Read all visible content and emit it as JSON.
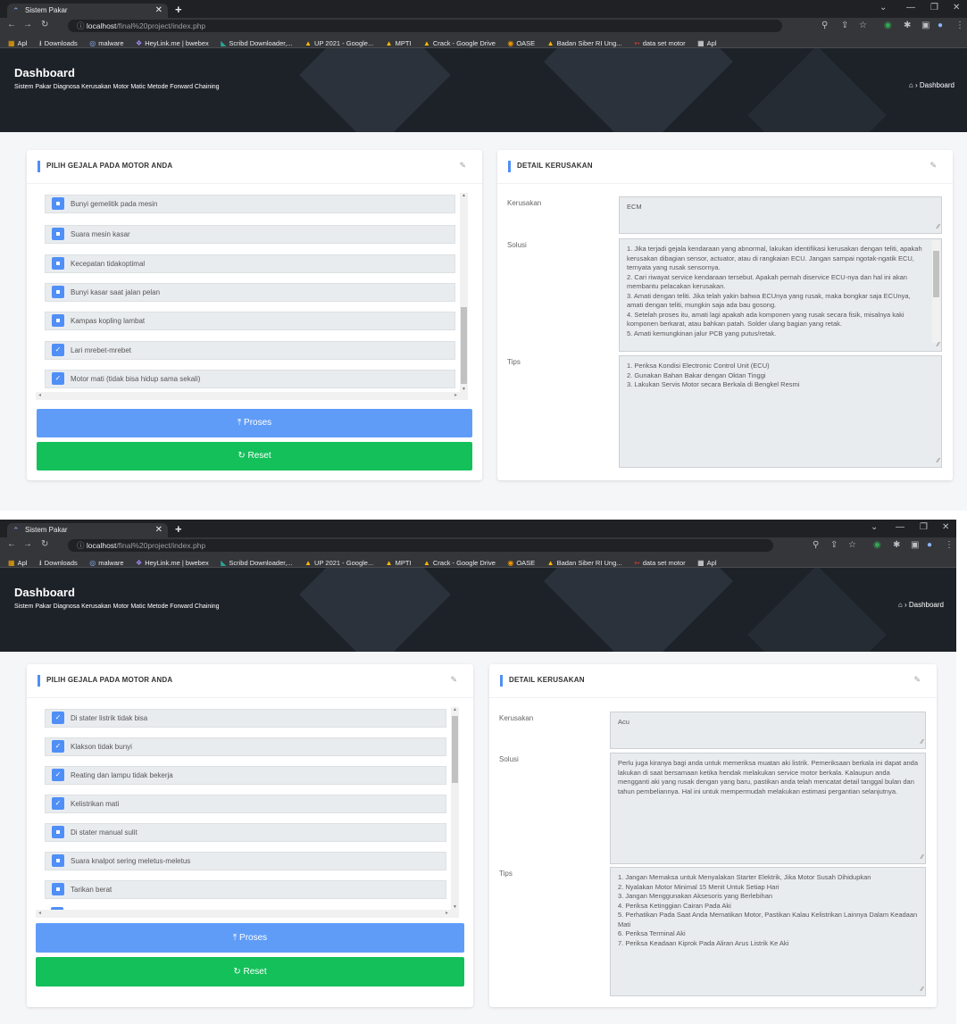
{
  "browser": {
    "tab_title": "Sistem Pakar",
    "url_host": "localhost",
    "url_path": "/final%20project/index.php",
    "bookmarks": [
      "Apl",
      "Downloads",
      "malware",
      "HeyLink.me | bwebex",
      "Scribd Downloader,...",
      "UP 2021 - Google...",
      "MPTI",
      "Crack - Google Drive",
      "OASE",
      "Badan Siber RI Ung...",
      "data set motor",
      "Apl"
    ]
  },
  "header": {
    "title": "Dashboard",
    "subtitle": "Sistem Pakar Diagnosa Kerusakan Motor Matic Metode Forward Chaining",
    "breadcrumb": "› Dashboard"
  },
  "panels": {
    "symptoms_title": "PILIH GEJALA PADA MOTOR ANDA",
    "detail_title": "DETAIL KERUSAKAN",
    "label_kerusakan": "Kerusakan",
    "label_solusi": "Solusi",
    "label_tips": "Tips",
    "proses_label": "Proses",
    "reset_label": "Reset"
  },
  "screen1": {
    "symptoms": [
      {
        "label": "Bunyi gemelitik pada mesin",
        "checked": false
      },
      {
        "label": "Suara mesin kasar",
        "checked": false
      },
      {
        "label": "Kecepatan tidakoptimal",
        "checked": false
      },
      {
        "label": "Bunyi kasar saat jalan pelan",
        "checked": false
      },
      {
        "label": "Kampas kopling lambat",
        "checked": false
      },
      {
        "label": "Lari mrebet-mrebet",
        "checked": true
      },
      {
        "label": "Motor mati (tidak bisa hidup sama sekali)",
        "checked": true
      }
    ],
    "kerusakan": "ECM",
    "solusi": "1. Jika terjadi gejala kendaraan yang abnormal, lakukan identifikasi kerusakan dengan teliti, apakah kerusakan dibagian sensor, actuator, atau di rangkaian ECU. Jangan sampai ngotak-ngatik ECU, ternyata yang rusak sensornya.\n2. Cari riwayat service kendaraan tersebut. Apakah pernah diservice ECU-nya dan hal ini akan membantu pelacakan kerusakan.\n3. Amati dengan teliti. Jika telah yakin bahwa ECUnya yang rusak, maka bongkar saja ECUnya, amati dengan teliti, mungkin saja ada bau gosong.\n4. Setelah proses itu, amati lagi apakah ada komponen yang rusak secara fisik, misalnya kaki komponen berkarat, atau bahkan patah. Solder ulang bagian yang retak.\n5. Amati kemungkinan jalur PCB yang putus/retak.",
    "tips": "1. Periksa Kondisi Electronic Control Unit (ECU)\n2. Gunakan Bahan Bakar dengan Oktan Tinggi\n3. Lakukan Servis Motor secara Berkala di Bengkel Resmi"
  },
  "screen2": {
    "symptoms": [
      {
        "label": "Di stater listrik tidak bisa",
        "checked": true
      },
      {
        "label": "Klakson tidak bunyi",
        "checked": true
      },
      {
        "label": "Reating dan lampu tidak bekerja",
        "checked": true
      },
      {
        "label": "Kelistrikan mati",
        "checked": true
      },
      {
        "label": "Di stater manual sulit",
        "checked": false
      },
      {
        "label": "Suara knalpot sering meletus-meletus",
        "checked": false
      },
      {
        "label": "Tarikan berat",
        "checked": false
      }
    ],
    "kerusakan": "Acu",
    "solusi": "Perlu juga kiranya bagi anda untuk memeriksa muatan aki listrik. Pemeriksaan berkala ini dapat anda lakukan di saat bersamaan ketika hendak melakukan service motor berkala. Kalaupun anda mengganti aki yang rusak dengan yang baru, pastikan anda telah mencatat detail tanggal bulan dan tahun pembeliannya. Hal ini untuk mempermudah melakukan estimasi pergantian selanjutnya.",
    "tips": "1. Jangan Memaksa untuk Menyalakan Starter Elektrik, Jika Motor Susah Dihidupkan\n2. Nyalakan Motor Minimal 15 Menit Untuk Setiap Hari\n3. Jangan Menggunakan Aksesoris yang Berlebihan\n4. Periksa Ketinggian Cairan Pada Aki\n5. Perhatikan Pada Saat Anda Mematikan Motor, Pastikan Kalau Kelistrikan Lainnya Dalam Keadaan Mati\n6. Periksa Terminal Aki\n7. Periksa Keadaan Kiprok Pada Aliran Arus Listrik Ke Aki"
  }
}
